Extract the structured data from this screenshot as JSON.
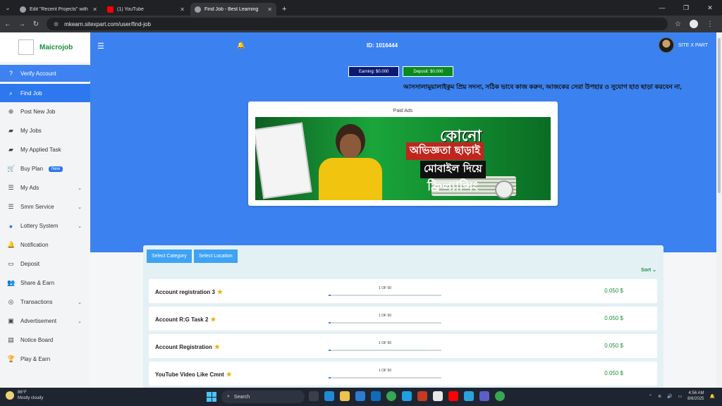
{
  "browser": {
    "tabs": [
      {
        "title": "Edit \"Recent Projects\" with Ele",
        "icon": "globe-icon",
        "active": false
      },
      {
        "title": "(1) YouTube",
        "icon": "youtube-icon",
        "active": false
      },
      {
        "title": "Find Job - Best Learning",
        "icon": "globe-icon",
        "active": true
      }
    ],
    "new_tab": "+",
    "url": "mkearn.sitexpart.com/user/find-job"
  },
  "brand": {
    "name": "Maicrojob"
  },
  "sidebar": {
    "items": [
      {
        "label": "Verify Account",
        "icon": "question-icon"
      },
      {
        "label": "Find Job",
        "icon": "search-icon"
      },
      {
        "label": "Post New Job",
        "icon": "plus-circle-icon"
      },
      {
        "label": "My Jobs",
        "icon": "briefcase-icon"
      },
      {
        "label": "My Applied Task",
        "icon": "briefcase-icon"
      },
      {
        "label": "Buy Plan",
        "icon": "cart-icon",
        "badge": "New"
      },
      {
        "label": "My Ads",
        "icon": "list-icon",
        "chevron": true
      },
      {
        "label": "Smm Service",
        "icon": "list-icon",
        "chevron": true
      },
      {
        "label": "Lottery System",
        "icon": "lottery-icon",
        "chevron": true
      },
      {
        "label": "Notification",
        "icon": "bell-icon"
      },
      {
        "label": "Deposit",
        "icon": "card-icon"
      },
      {
        "label": "Share & Earn",
        "icon": "users-icon"
      },
      {
        "label": "Transactions",
        "icon": "coins-icon",
        "chevron": true
      },
      {
        "label": "Advertisement",
        "icon": "ad-icon",
        "chevron": true
      },
      {
        "label": "Notice Board",
        "icon": "board-icon"
      },
      {
        "label": "Play & Earn",
        "icon": "trophy-icon"
      }
    ]
  },
  "topnav": {
    "user_id": "ID: 1016444",
    "username": "SITE X PART"
  },
  "wallet": {
    "earning": "Earning: $0.000",
    "deposit": "Deposit: $0.000"
  },
  "marquee": "আসসালামুয়ালাইকুম প্রিয় সদস্য, সঠিক ভাবে কাজ করুন, আজকের সেরা উপহার ও সুযোগ হাত ছাড়া করবেন না,",
  "ads": {
    "title": "Paid Ads",
    "banner_text": [
      "কোনো",
      "অভিজ্ঞতা ছাড়াই",
      "মোবাইল দিয়ে",
      "ফ্রিল্যান্সিং"
    ]
  },
  "filters": {
    "category": "Select Category",
    "location": "Select Location",
    "sort": "Sort"
  },
  "jobs": [
    {
      "title": "Account registration 3",
      "progress": "1 OF 50",
      "fraction": 0.02,
      "price": "0.050 $"
    },
    {
      "title": "Account R:G Task 2",
      "progress": "1 OF 50",
      "fraction": 0.02,
      "price": "0.050 $"
    },
    {
      "title": "Account Registration",
      "progress": "1 OF 50",
      "fraction": 0.02,
      "price": "0.050 $"
    },
    {
      "title": "YouTube Video Like Cmnt",
      "progress": "1 OF 50",
      "fraction": 0.02,
      "price": "0.050 $"
    }
  ],
  "taskbar": {
    "temp": "86°F",
    "weather": "Mostly cloudy",
    "search": "Search",
    "time": "4:56 AM",
    "date": "8/6/2025"
  },
  "colors": {
    "primary": "#3b82f0",
    "green": "#1b8f3c",
    "earning_bg": "#0b1a70",
    "deposit_bg": "#0a8a1e"
  }
}
